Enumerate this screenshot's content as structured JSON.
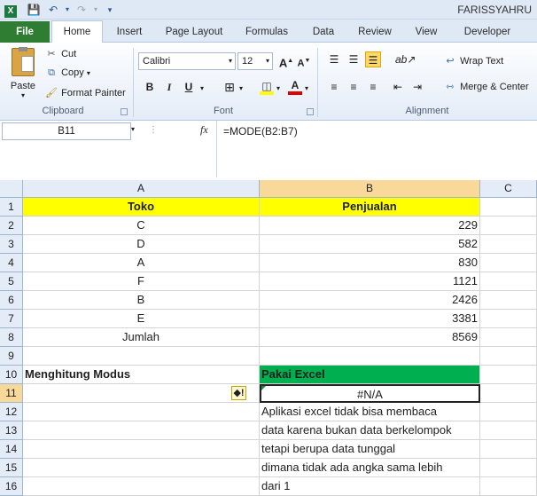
{
  "window": {
    "title": "FARISSYAHRU"
  },
  "tabs": [
    "File",
    "Home",
    "Insert",
    "Page Layout",
    "Formulas",
    "Data",
    "Review",
    "View",
    "Developer"
  ],
  "clipboard": {
    "paste": "Paste",
    "cut": "Cut",
    "copy": "Copy",
    "format_painter": "Format Painter",
    "label": "Clipboard"
  },
  "font": {
    "name": "Calibri",
    "size": "12",
    "bold": "B",
    "italic": "I",
    "underline": "U",
    "label": "Font"
  },
  "alignment": {
    "wrap_text": "Wrap Text",
    "merge_center": "Merge & Center",
    "label": "Alignment"
  },
  "formula_bar": {
    "name_box": "B11",
    "fx": "fx",
    "formula": "=MODE(B2:B7)"
  },
  "columns": [
    "A",
    "B",
    "C"
  ],
  "rows": [
    "1",
    "2",
    "3",
    "4",
    "5",
    "6",
    "7",
    "8",
    "9",
    "10",
    "11",
    "12",
    "13",
    "14",
    "15",
    "16"
  ],
  "sheet": {
    "header_a": "Toko",
    "header_b": "Penjualan",
    "data": [
      {
        "toko": "C",
        "penjualan": "229"
      },
      {
        "toko": "D",
        "penjualan": "582"
      },
      {
        "toko": "A",
        "penjualan": "830"
      },
      {
        "toko": "F",
        "penjualan": "1121"
      },
      {
        "toko": "B",
        "penjualan": "2426"
      },
      {
        "toko": "E",
        "penjualan": "3381"
      }
    ],
    "jumlah_label": "Jumlah",
    "jumlah_value": "8569",
    "a10": "Menghitung Modus",
    "b10": "Pakai Excel",
    "b11": "#N/A",
    "notes": [
      "Aplikasi excel tidak bisa membaca",
      "data karena bukan data berkelompok",
      "tetapi berupa data tunggal",
      "dimana tidak ada angka sama lebih",
      "dari 1"
    ]
  },
  "colors": {
    "header_fill": "#ffff00",
    "excel_fill": "#00b050",
    "file_tab": "#2e7d32"
  }
}
